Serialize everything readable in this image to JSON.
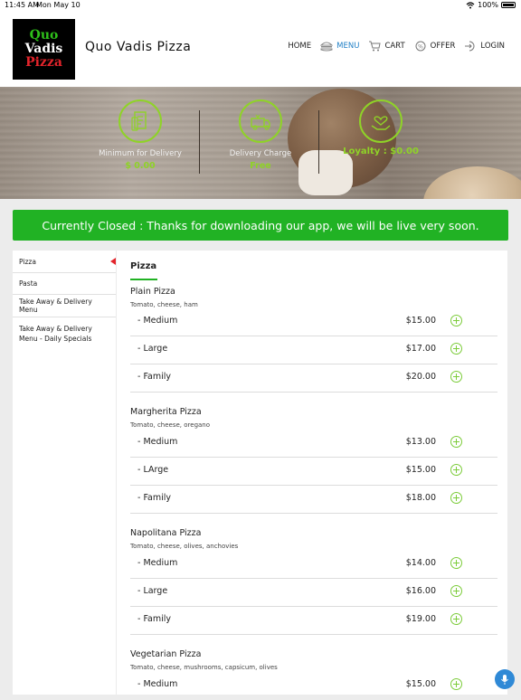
{
  "status": {
    "time": "11:45 AM",
    "date": "Mon May 10",
    "battery": "100%"
  },
  "header": {
    "logo_lines": [
      "Quo",
      "Vadis",
      "Pizza"
    ],
    "brand": "Quo Vadis Pizza",
    "nav": [
      {
        "label": "HOME",
        "icon": "home"
      },
      {
        "label": "MENU",
        "icon": "burger-icon",
        "active": true
      },
      {
        "label": "CART",
        "icon": "cart-icon"
      },
      {
        "label": "OFFER",
        "icon": "offer-icon"
      },
      {
        "label": "LOGIN",
        "icon": "login-icon"
      }
    ]
  },
  "hero": {
    "items": [
      {
        "icon": "bill-icon",
        "label": "Minimum for Delivery",
        "value": "$ 0.00"
      },
      {
        "icon": "delivery-truck-icon",
        "label": "Delivery Charge",
        "value": "Free"
      },
      {
        "icon": "loyalty-heart-hand-icon",
        "label": "",
        "value": "Loyalty : $0.00"
      }
    ]
  },
  "banner": "Currently Closed : Thanks for downloading our app, we will be live very soon.",
  "sidebar": [
    {
      "label": "Pizza",
      "active": true
    },
    {
      "label": "Pasta"
    },
    {
      "label": "Take Away & Delivery Menu"
    },
    {
      "label": "Take Away & Delivery Menu - Daily Specials"
    }
  ],
  "menu": {
    "category": "Pizza",
    "items": [
      {
        "name": "Plain Pizza",
        "desc": "Tomato, cheese, ham",
        "variants": [
          {
            "name": "- Medium",
            "price": "$15.00"
          },
          {
            "name": "- Large",
            "price": "$17.00"
          },
          {
            "name": "- Family",
            "price": "$20.00"
          }
        ]
      },
      {
        "name": "Margherita Pizza",
        "desc": "Tomato, cheese, oregano",
        "variants": [
          {
            "name": "- Medium",
            "price": "$13.00"
          },
          {
            "name": "- LArge",
            "price": "$15.00"
          },
          {
            "name": "- Family",
            "price": "$18.00"
          }
        ]
      },
      {
        "name": "Napolitana Pizza",
        "desc": "Tomato, cheese, olives, anchovies",
        "variants": [
          {
            "name": "- Medium",
            "price": "$14.00"
          },
          {
            "name": "- Large",
            "price": "$16.00"
          },
          {
            "name": "- Family",
            "price": "$19.00"
          }
        ]
      },
      {
        "name": "Vegetarian Pizza",
        "desc": "Tomato, cheese, mushrooms, capsicum, olives",
        "variants": [
          {
            "name": "- Medium",
            "price": "$15.00"
          }
        ]
      }
    ]
  },
  "colors": {
    "accent_green": "#21b224",
    "icon_green": "#8fd327",
    "active_blue": "#1f7fc6",
    "logo_red": "#e3242b"
  }
}
